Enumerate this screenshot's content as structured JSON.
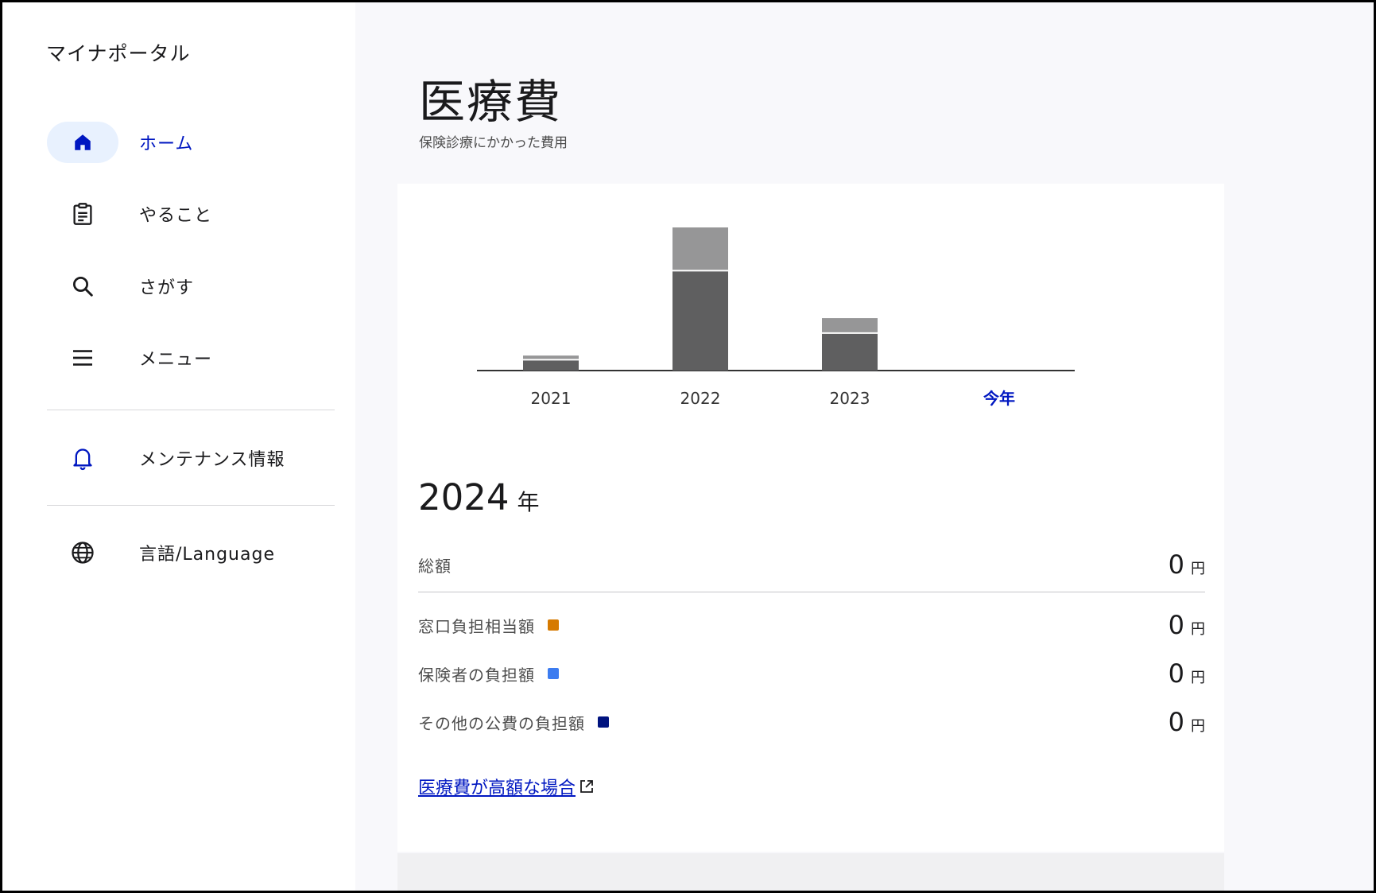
{
  "app": {
    "title": "マイナポータル"
  },
  "nav": {
    "items": [
      {
        "label": "ホーム",
        "icon": "home-icon",
        "active": true
      },
      {
        "label": "やること",
        "icon": "clipboard-icon"
      },
      {
        "label": "さがす",
        "icon": "search-icon"
      },
      {
        "label": "メニュー",
        "icon": "menu-icon"
      }
    ],
    "extra": [
      {
        "label": "メンテナンス情報",
        "icon": "bell-icon"
      },
      {
        "label": "言語/Language",
        "icon": "globe-icon"
      }
    ]
  },
  "page": {
    "title": "医療費",
    "subtitle": "保険診療にかかった費用"
  },
  "chart_data": {
    "type": "bar",
    "stacked": true,
    "categories": [
      "2021",
      "2022",
      "2023",
      "今年"
    ],
    "series": [
      {
        "values": [
          13,
          120,
          45,
          0
        ],
        "color": "#5f5f60"
      },
      {
        "values": [
          5,
          52,
          18,
          0
        ],
        "color": "#969697"
      }
    ],
    "highlight_category": "今年",
    "highlight_color": "#0017c1"
  },
  "summary": {
    "year": "2024",
    "year_unit": "年",
    "total": {
      "label": "総額",
      "value": "0",
      "unit": "円"
    },
    "breakdown": [
      {
        "label": "窓口負担相当額",
        "value": "0",
        "unit": "円",
        "color": "#d67a00"
      },
      {
        "label": "保険者の負担額",
        "value": "0",
        "unit": "円",
        "color": "#3c7cf0"
      },
      {
        "label": "その他の公費の負担額",
        "value": "0",
        "unit": "円",
        "color": "#00137f"
      }
    ]
  },
  "help_link": {
    "label": "医療費が高額な場合"
  }
}
